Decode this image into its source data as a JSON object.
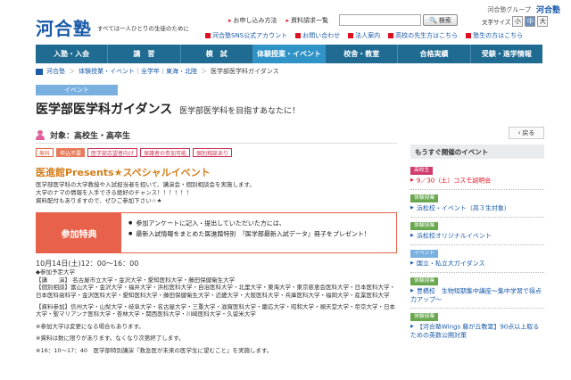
{
  "header": {
    "group_label": "河合塾グループ",
    "group_brand": "河合塾",
    "logo": "河合塾",
    "tagline": "すべては一人ひとりの生徒のために",
    "top_links": [
      "お申し込み方法",
      "資料請求一覧"
    ],
    "search_placeholder": "",
    "search_button": "検索",
    "fontsize_label": "文字サイズ",
    "fontsizes": [
      "小",
      "中",
      "大"
    ],
    "sub_links": [
      "河合塾SNS公式アカウント",
      "お問い合わせ",
      "法人案内",
      "高校の先生方はこちら",
      "塾生の方はこちら"
    ]
  },
  "nav": [
    "入塾・入会",
    "講　習",
    "模　試",
    "体験授業・イベント",
    "校舎・教室",
    "合格実績",
    "受験・進学情報"
  ],
  "breadcrumb": [
    "河合塾",
    "体験授業・イベント｜全学年｜東海・北陸",
    "医学部医学科ガイダンス"
  ],
  "event_tag": "イベント",
  "title": "医学部医学科ガイダンス",
  "subtitle": "医学部医学科を目指すあなたに！",
  "target": "対象：高校生・高卒生",
  "badges": [
    "無料",
    "申込不要",
    "医学部志望者向け",
    "保護者の参加可能",
    "個別相談あり"
  ],
  "headline": "医進館Presents★スペシャルイベント",
  "description": [
    "医学部医学科の大学教授や入試担当者を招いて、講演会・個別相談会を実施します。",
    "大学のナマの情報を入手できる絶好のチャンス！！！！！！",
    "資料配付もありますので、ぜひご参加下さい☆★"
  ],
  "benefit": {
    "head": "参加特典",
    "items": [
      "参加アンケートに記入・提出していただいた方には、",
      "最新入試情報をまとめた医進館特別　『医学部最新入試データ』冊子をプレゼント！"
    ]
  },
  "details": {
    "time": "10月14日(土)12：00～16：00",
    "lines": [
      "◆参加予定大学",
      "【講　　演】 名古屋市立大学・金沢大学・愛知医科大学・藤田保健衛生大学",
      "【個別相談】富山大学・金沢大学・福井大学・浜松医科大学・自治医科大学・北里大学・東海大学・東京慈恵会医科大学・日本医科大学・日本医科歯科学・金沢医科大学・愛知医科大学・藤田保健衛生大学・近畿大学・大阪医科大学・兵庫医科大学・福岡大学・産業医科大学"
    ],
    "lines2": [
      "【資料参加】信州大学・山梨大学・岐阜大学・名古屋大学・三重大学・滋賀医科大学・慶応大学・昭和大学・順天堂大学・帝京大学・日本大学・聖マリアンナ医科大学・杏林大学・関西医科大学・川崎医科大学・久留米大学",
      "※参加大学は変更になる場合もあります。",
      "※資料は数に限りがあります。なくなり次第終了します。",
      "※16：10～17：40　医学部特別講演『救急医が未来の医学生に望むこと』を実施します。"
    ]
  },
  "sidebar": {
    "back": "戻る",
    "heading": "もうすぐ開催のイベント",
    "items": [
      {
        "cat": "高校生",
        "cat_color": "#d13b6e",
        "link": "9／30（土）コスモ説明会",
        "red": true
      },
      {
        "cat": "体験授業",
        "cat_color": "#6aa84f",
        "link": "浜松校・イベント（高３生対象）",
        "red": false
      },
      {
        "cat": "体験授業",
        "cat_color": "#6aa84f",
        "link": "浜松校オリジナルイベント",
        "red": false
      },
      {
        "cat": "イベント",
        "cat_color": "#7ab0e0",
        "link": "国立・私立大ガイダンス",
        "red": false
      },
      {
        "cat": "体験授業",
        "cat_color": "#6aa84f",
        "link": "豊橋校　生物短期集中講座～集中学習で得点力アップ～",
        "red": false
      },
      {
        "cat": "体験授業",
        "cat_color": "#6aa84f",
        "link": "【河合塾Wings 藤が丘教室】90点以上取るための英数公開対策",
        "red": false
      }
    ]
  }
}
